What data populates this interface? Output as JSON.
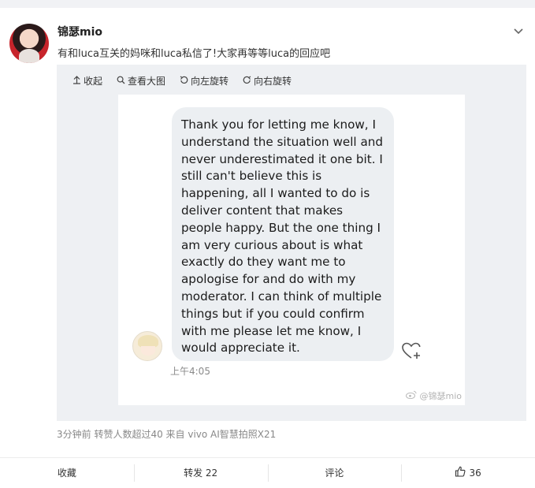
{
  "post": {
    "username": "锦瑟mio",
    "text": "有和luca互关的妈咪和luca私信了!大家再等等luca的回应吧",
    "meta": "3分钟前 转赞人数超过40  来自 vivo AI智慧拍照X21"
  },
  "toolbar": {
    "collapse": "收起",
    "view_large": "查看大图",
    "rotate_left": "向左旋转",
    "rotate_right": "向右旋转"
  },
  "screenshot": {
    "message": "Thank you for letting me know, I understand the situation well and never underestimated it one bit. I still can't believe this is happening, all I wanted to do is deliver content that makes people happy. But the one thing I am very curious about is what exactly do they want me to apologise for and do with my moderator. I can think of multiple things but if you could confirm with me please let me know, I would appreciate it.",
    "time": "上午4:05",
    "watermark": "@锦瑟mio"
  },
  "actions": {
    "favorite": "收藏",
    "repost": "转发 22",
    "comment": "评论",
    "like_count": "36"
  },
  "icons": {
    "chevron": "chevron-down-icon",
    "collapse": "collapse-arrow-icon",
    "search": "search-icon",
    "rotate_left": "rotate-left-icon",
    "rotate_right": "rotate-right-icon",
    "heart": "heart-plus-icon",
    "weibo": "weibo-icon",
    "thumb": "thumbs-up-icon"
  }
}
